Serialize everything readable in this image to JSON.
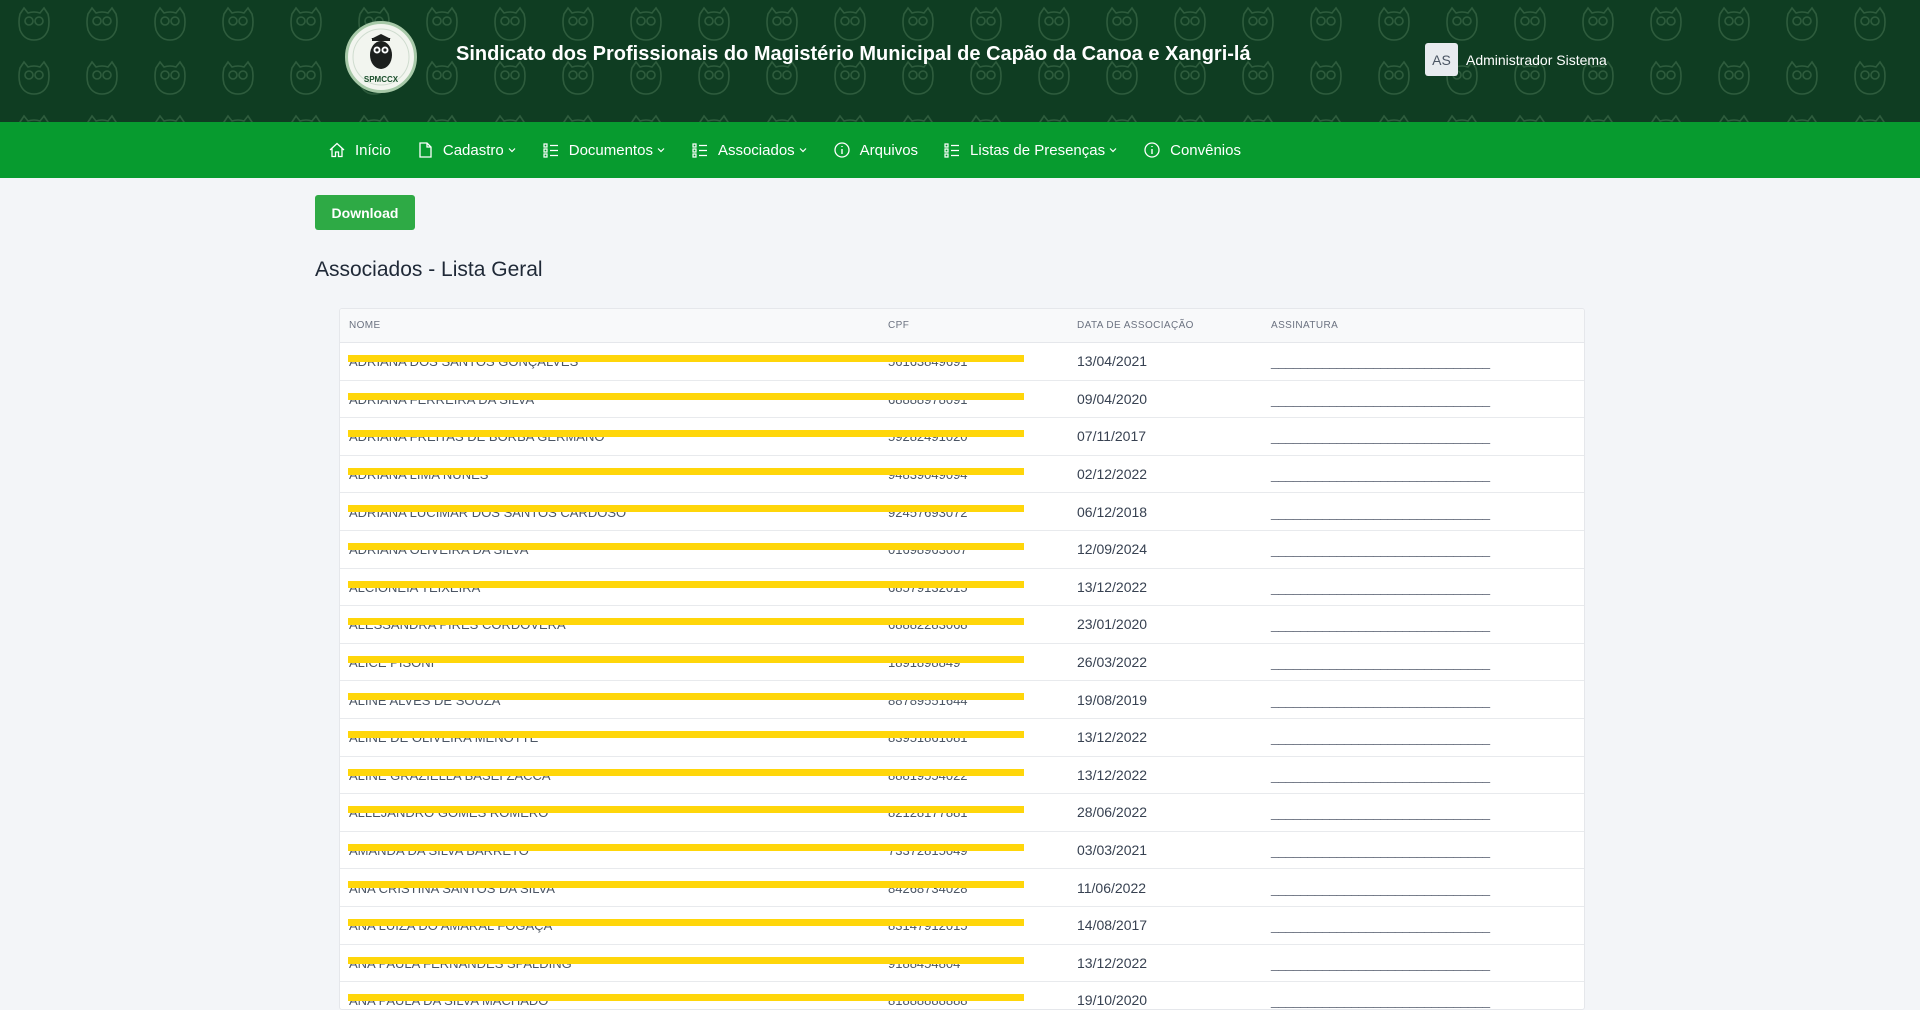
{
  "header": {
    "logo_text": "SPMCCX",
    "title": "Sindicato dos Profissionais do Magistério Municipal de Capão da Canoa e Xangri-lá",
    "user_initials": "AS",
    "user_name": "Administrador Sistema"
  },
  "nav": {
    "items": [
      {
        "label": "Início",
        "icon": "home-icon"
      },
      {
        "label": "Cadastro",
        "icon": "document-icon"
      },
      {
        "label": "Documentos",
        "icon": "list-icon"
      },
      {
        "label": "Associados",
        "icon": "list-icon"
      },
      {
        "label": "Arquivos",
        "icon": "info-icon"
      },
      {
        "label": "Listas de Presenças",
        "icon": "list-icon"
      },
      {
        "label": "Convênios",
        "icon": "info-icon"
      }
    ]
  },
  "main": {
    "download_label": "Download",
    "page_title": "Associados - Lista Geral",
    "table": {
      "headers": [
        "NOME",
        "CPF",
        "DATA DE ASSOCIAÇÃO",
        "ASSINATURA"
      ],
      "rows": [
        {
          "nome": "ADRIANA DOS SANTOS GONÇALVES",
          "cpf": "56163849691",
          "data": "13/04/2021",
          "assinatura": "______________________________"
        },
        {
          "nome": "ADRIANA FERREIRA DA SILVA",
          "cpf": "68888978091",
          "data": "09/04/2020",
          "assinatura": "______________________________"
        },
        {
          "nome": "ADRIANA FREITAS DE BORBA GERMANO",
          "cpf": "59282491020",
          "data": "07/11/2017",
          "assinatura": "______________________________"
        },
        {
          "nome": "ADRIANA LIMA NUNES",
          "cpf": "94839049094",
          "data": "02/12/2022",
          "assinatura": "______________________________"
        },
        {
          "nome": "ADRIANA LUCIMAR DOS SANTOS CARDOSO",
          "cpf": "92457693072",
          "data": "06/12/2018",
          "assinatura": "______________________________"
        },
        {
          "nome": "ADRIANA OLIVEIRA DA SILVA",
          "cpf": "01698963007",
          "data": "12/09/2024",
          "assinatura": "______________________________"
        },
        {
          "nome": "ALCIONEIA TEIXEIRA",
          "cpf": "68579132015",
          "data": "13/12/2022",
          "assinatura": "______________________________"
        },
        {
          "nome": "ALESSANDRA PIRES CORDOVERA",
          "cpf": "68882283068",
          "data": "23/01/2020",
          "assinatura": "______________________________"
        },
        {
          "nome": "ALICE PISONI",
          "cpf": "1891898849",
          "data": "26/03/2022",
          "assinatura": "______________________________"
        },
        {
          "nome": "ALINE ALVES DE SOUZA",
          "cpf": "88789551644",
          "data": "19/08/2019",
          "assinatura": "______________________________"
        },
        {
          "nome": "ALINE DE OLIVEIRA MENOTTE",
          "cpf": "83951861081",
          "data": "13/12/2022",
          "assinatura": "______________________________"
        },
        {
          "nome": "ALINE GRAZIELLA BASEI ZACCA",
          "cpf": "88819554022",
          "data": "13/12/2022",
          "assinatura": "______________________________"
        },
        {
          "nome": "ALLEJANDRO GOMES ROMERO",
          "cpf": "82128177881",
          "data": "28/06/2022",
          "assinatura": "______________________________"
        },
        {
          "nome": "AMANDA DA SILVA BARRETO",
          "cpf": "73372815049",
          "data": "03/03/2021",
          "assinatura": "______________________________"
        },
        {
          "nome": "ANA CRISTINA SANTOS DA SILVA",
          "cpf": "84268734028",
          "data": "11/06/2022",
          "assinatura": "______________________________"
        },
        {
          "nome": "ANA LUIZA DO AMARAL FOGAÇA",
          "cpf": "83147912015",
          "data": "14/08/2017",
          "assinatura": "______________________________"
        },
        {
          "nome": "ANA PAULA FERNANDES SPALDING",
          "cpf": "9188454804",
          "data": "13/12/2022",
          "assinatura": "______________________________"
        },
        {
          "nome": "ANA PAULA DA SILVA MACHADO",
          "cpf": "81888888888",
          "data": "19/10/2020",
          "assinatura": "______________________________"
        }
      ]
    }
  },
  "colors": {
    "header_bg": "#0f3d22",
    "nav_bg": "#079b2f",
    "button_bg": "#2eaa45",
    "redaction": "#ffd60a"
  }
}
